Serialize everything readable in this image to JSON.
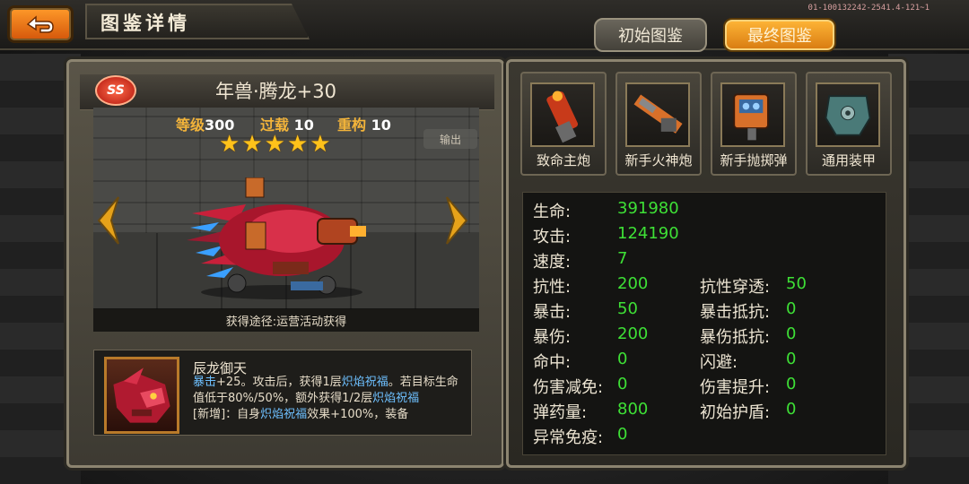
{
  "header": {
    "title": "图鉴详情",
    "build_id": "01-100132242-2541.4-121~1",
    "tabs": [
      {
        "label": "初始图鉴",
        "active": false
      },
      {
        "label": "最终图鉴",
        "active": true
      }
    ]
  },
  "unit": {
    "rank": "SS",
    "name": "年兽·腾龙+30",
    "level_label": "等级",
    "level": "300",
    "overload_label": "过载",
    "overload": "10",
    "rebuild_label": "重构",
    "rebuild": "10",
    "stars": 5,
    "output_tag": "输出",
    "source": "获得途径:运营活动获得"
  },
  "skill": {
    "name": "辰龙御天",
    "desc_parts": [
      {
        "text": "暴击",
        "hl": true
      },
      {
        "text": "+25。攻击后，获得1层",
        "hl": false
      },
      {
        "text": "炽焰祝福",
        "hl": true
      },
      {
        "text": "。若目标生命值低于80%/50%，额外获得1/2层",
        "hl": false
      },
      {
        "text": "炽焰祝福",
        "hl": true
      },
      {
        "text": "[新增]：自身",
        "hl": false
      },
      {
        "text": "炽焰祝福",
        "hl": true
      },
      {
        "text": "效果+100%，装备",
        "hl": false
      }
    ]
  },
  "equipment": [
    {
      "label": "致命主炮",
      "icon": "cannon-icon"
    },
    {
      "label": "新手火神炮",
      "icon": "gatling-icon"
    },
    {
      "label": "新手抛掷弹",
      "icon": "grenade-launcher-icon"
    },
    {
      "label": "通用装甲",
      "icon": "armor-icon"
    }
  ],
  "stats_left": [
    {
      "label": "生命:",
      "value": "391980"
    },
    {
      "label": "攻击:",
      "value": "124190"
    },
    {
      "label": "速度:",
      "value": "7"
    },
    {
      "label": "抗性:",
      "value": "200"
    },
    {
      "label": "暴击:",
      "value": "50"
    },
    {
      "label": "暴伤:",
      "value": "200"
    },
    {
      "label": "命中:",
      "value": "0"
    },
    {
      "label": "伤害减免:",
      "value": "0"
    },
    {
      "label": "弹药量:",
      "value": "800"
    },
    {
      "label": "异常免疫:",
      "value": "0"
    }
  ],
  "stats_right": [
    {
      "label": "抗性穿透:",
      "value": "50"
    },
    {
      "label": "暴击抵抗:",
      "value": "0"
    },
    {
      "label": "暴伤抵抗:",
      "value": "0"
    },
    {
      "label": "闪避:",
      "value": "0"
    },
    {
      "label": "伤害提升:",
      "value": "0"
    },
    {
      "label": "初始护盾:",
      "value": "0"
    }
  ],
  "colors": {
    "accent": "#f3b43a",
    "stat_value": "#3ee036",
    "highlight": "#6ec0ff"
  }
}
